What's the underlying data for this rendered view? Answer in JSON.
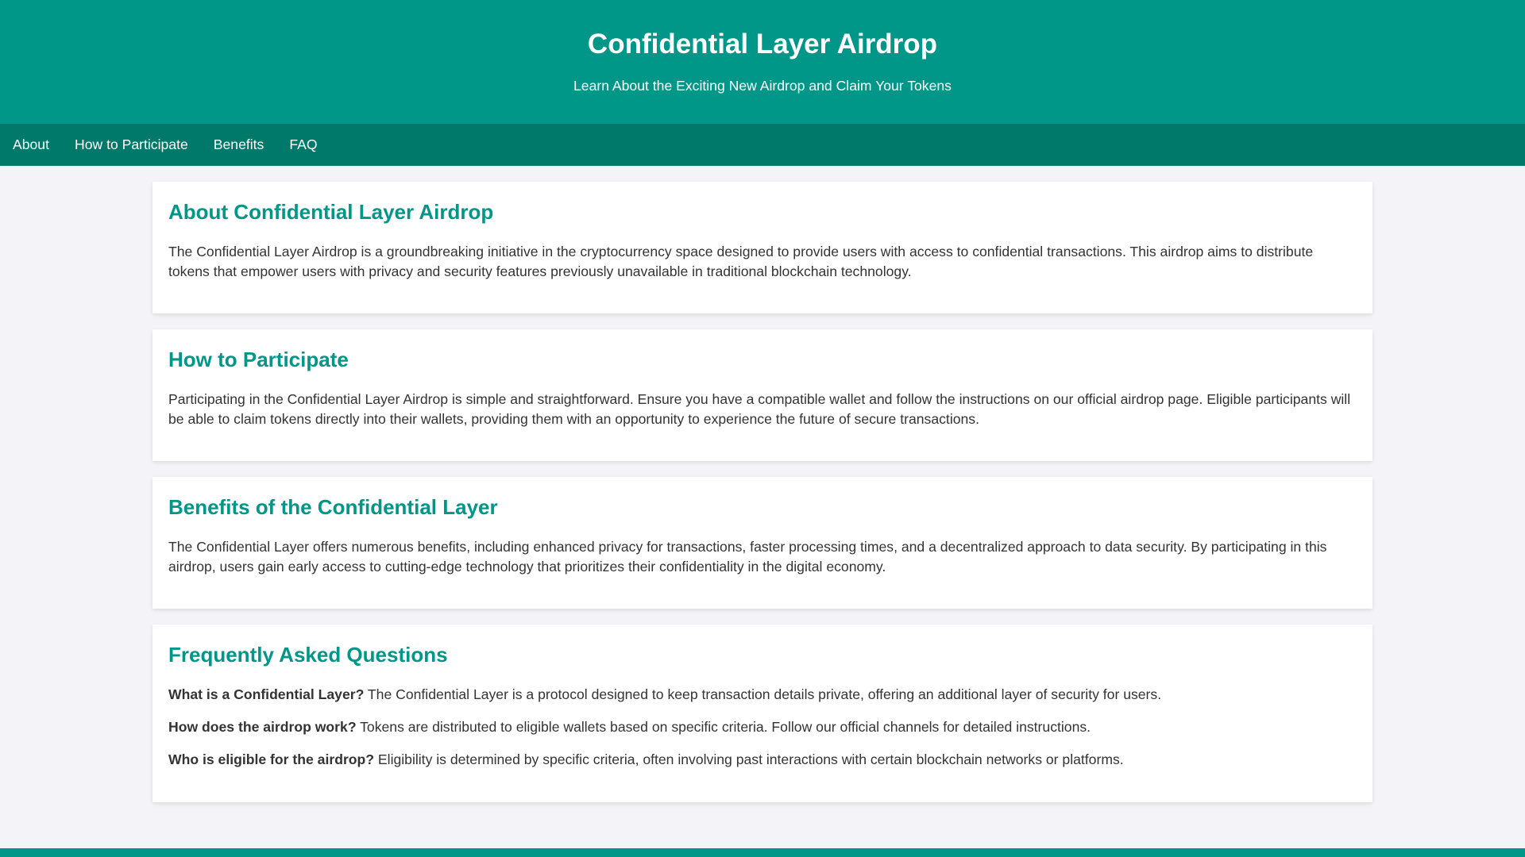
{
  "header": {
    "title": "Confidential Layer Airdrop",
    "subtitle": "Learn About the Exciting New Airdrop and Claim Your Tokens"
  },
  "nav": [
    "About",
    "How to Participate",
    "Benefits",
    "FAQ"
  ],
  "sections": [
    {
      "title": "About Confidential Layer Airdrop",
      "text": "The Confidential Layer Airdrop is a groundbreaking initiative in the cryptocurrency space designed to provide users with access to confidential transactions. This airdrop aims to distribute tokens that empower users with privacy and security features previously unavailable in traditional blockchain technology."
    },
    {
      "title": "How to Participate",
      "text": "Participating in the Confidential Layer Airdrop is simple and straightforward. Ensure you have a compatible wallet and follow the instructions on our official airdrop page. Eligible participants will be able to claim tokens directly into their wallets, providing them with an opportunity to experience the future of secure transactions."
    },
    {
      "title": "Benefits of the Confidential Layer",
      "text": "The Confidential Layer offers numerous benefits, including enhanced privacy for transactions, faster processing times, and a decentralized approach to data security. By participating in this airdrop, users gain early access to cutting-edge technology that prioritizes their confidentiality in the digital economy."
    }
  ],
  "faq": {
    "title": "Frequently Asked Questions",
    "items": [
      {
        "q": "What is a Confidential Layer?",
        "a": " The Confidential Layer is a protocol designed to keep transaction details private, offering an additional layer of security for users."
      },
      {
        "q": "How does the airdrop work?",
        "a": " Tokens are distributed to eligible wallets based on specific criteria. Follow our official channels for detailed instructions."
      },
      {
        "q": "Who is eligible for the airdrop?",
        "a": " Eligibility is determined by specific criteria, often involving past interactions with certain blockchain networks or platforms."
      }
    ]
  }
}
